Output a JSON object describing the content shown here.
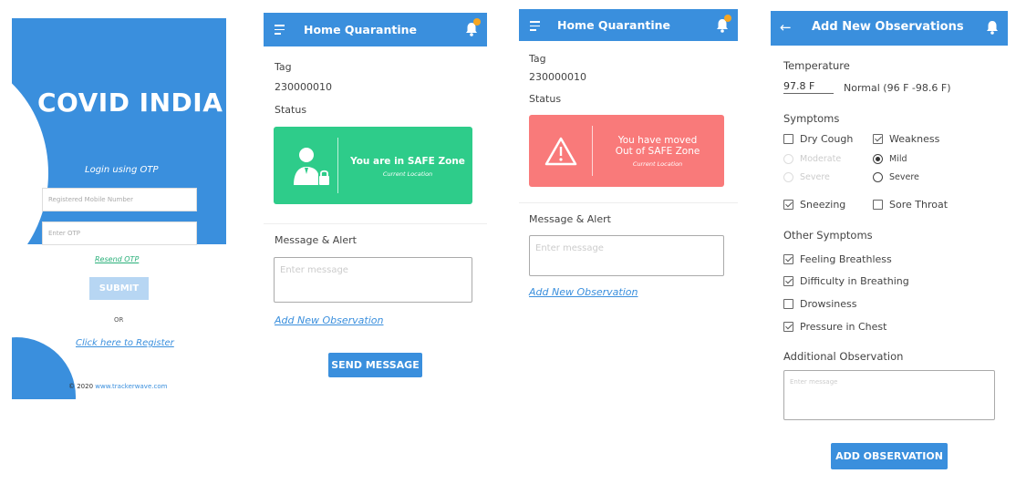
{
  "login": {
    "app_title": "COVID INDIA",
    "login_label": "Login using OTP",
    "mobile_placeholder": "Registered Mobile Number",
    "otp_placeholder": "Enter OTP",
    "resend_label": "Resend OTP",
    "submit_label": "SUBMIT",
    "or_label": "OR",
    "register_label": "Click here to Register",
    "copyright_prefix": "© 2020",
    "copyright_link": "www.trackerwave.com"
  },
  "home_safe": {
    "title": "Home Quarantine",
    "tag_label": "Tag",
    "tag_value": "230000010",
    "status_label": "Status",
    "zone_title": "You are in SAFE Zone",
    "zone_sub": "Current Location",
    "message_label": "Message & Alert",
    "message_placeholder": "Enter message",
    "add_observation_link": "Add New Observation",
    "send_label": "SEND MESSAGE"
  },
  "home_alert": {
    "title": "Home Quarantine",
    "tag_label": "Tag",
    "tag_value": "230000010",
    "status_label": "Status",
    "zone_title_1": "You have moved",
    "zone_title_2": "Out of SAFE Zone",
    "zone_sub": "Current Location",
    "message_label": "Message & Alert",
    "message_placeholder": "Enter message",
    "add_observation_link": "Add New Observation"
  },
  "observation": {
    "title": "Add New Observations",
    "temperature_label": "Temperature",
    "temperature_value": "97.8 F",
    "temperature_note": "Normal (96 F -98.6 F)",
    "symptoms_label": "Symptoms",
    "symptoms": {
      "dry_cough": {
        "label": "Dry Cough",
        "checked": false
      },
      "weakness": {
        "label": "Weakness",
        "checked": true
      },
      "sneezing": {
        "label": "Sneezing",
        "checked": true
      },
      "sore_throat": {
        "label": "Sore Throat",
        "checked": false
      }
    },
    "severity_left": [
      "Moderate",
      "Severe"
    ],
    "severity_right": [
      {
        "label": "Mild",
        "selected": true
      },
      {
        "label": "Severe",
        "selected": false
      }
    ],
    "other_symptoms_label": "Other Symptoms",
    "other_symptoms": [
      {
        "label": "Feeling Breathless",
        "checked": true
      },
      {
        "label": "Difficulty in Breathing",
        "checked": true
      },
      {
        "label": "Drowsiness",
        "checked": false
      },
      {
        "label": "Pressure in Chest",
        "checked": true
      }
    ],
    "additional_label": "Additional Observation",
    "additional_placeholder": "Enter message",
    "add_button_label": "ADD OBSERVATION"
  },
  "colors": {
    "primary": "#3a8fdd",
    "safe": "#2ecc8a",
    "danger": "#f97a7a",
    "badge": "#f5a623"
  }
}
